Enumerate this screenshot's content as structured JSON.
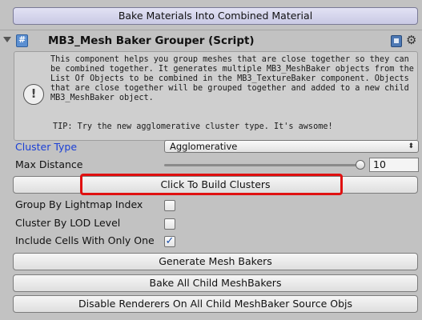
{
  "buttons": {
    "bake_combined": "Bake Materials Into Combined Material",
    "build_clusters": "Click To Build Clusters",
    "generate_bakers": "Generate Mesh Bakers",
    "bake_all": "Bake All Child MeshBakers",
    "disable_renderers": "Disable Renderers On All Child MeshBaker Source Objs"
  },
  "component": {
    "title": "MB3_Mesh Baker Grouper (Script)",
    "icons": [
      "script-icon",
      "book-icon",
      "gear-icon"
    ]
  },
  "help": {
    "text": "This component helps you group meshes that are close together so they can be combined together. It generates multiple MB3_MeshBaker objects from the List Of Objects to be combined in the MB3_TextureBaker component. Objects that are close together will be grouped together and added to a new child MB3_MeshBaker object.",
    "tip": "TIP: Try the new agglomerative cluster type. It's awsome!",
    "icon_glyph": "!"
  },
  "fields": {
    "cluster_type_label": "Cluster Type",
    "cluster_type_value": "Agglomerative",
    "max_distance_label": "Max Distance",
    "max_distance_value": "10",
    "group_lightmap_label": "Group By Lightmap Index",
    "group_lightmap_checked": false,
    "cluster_lod_label": "Cluster By LOD Level",
    "cluster_lod_checked": false,
    "include_cells_label": "Include Cells With Only One",
    "include_cells_checked": true,
    "checkmark": "✓"
  },
  "colors": {
    "highlight": "#e01010",
    "label_blue": "#1a3fd6"
  }
}
